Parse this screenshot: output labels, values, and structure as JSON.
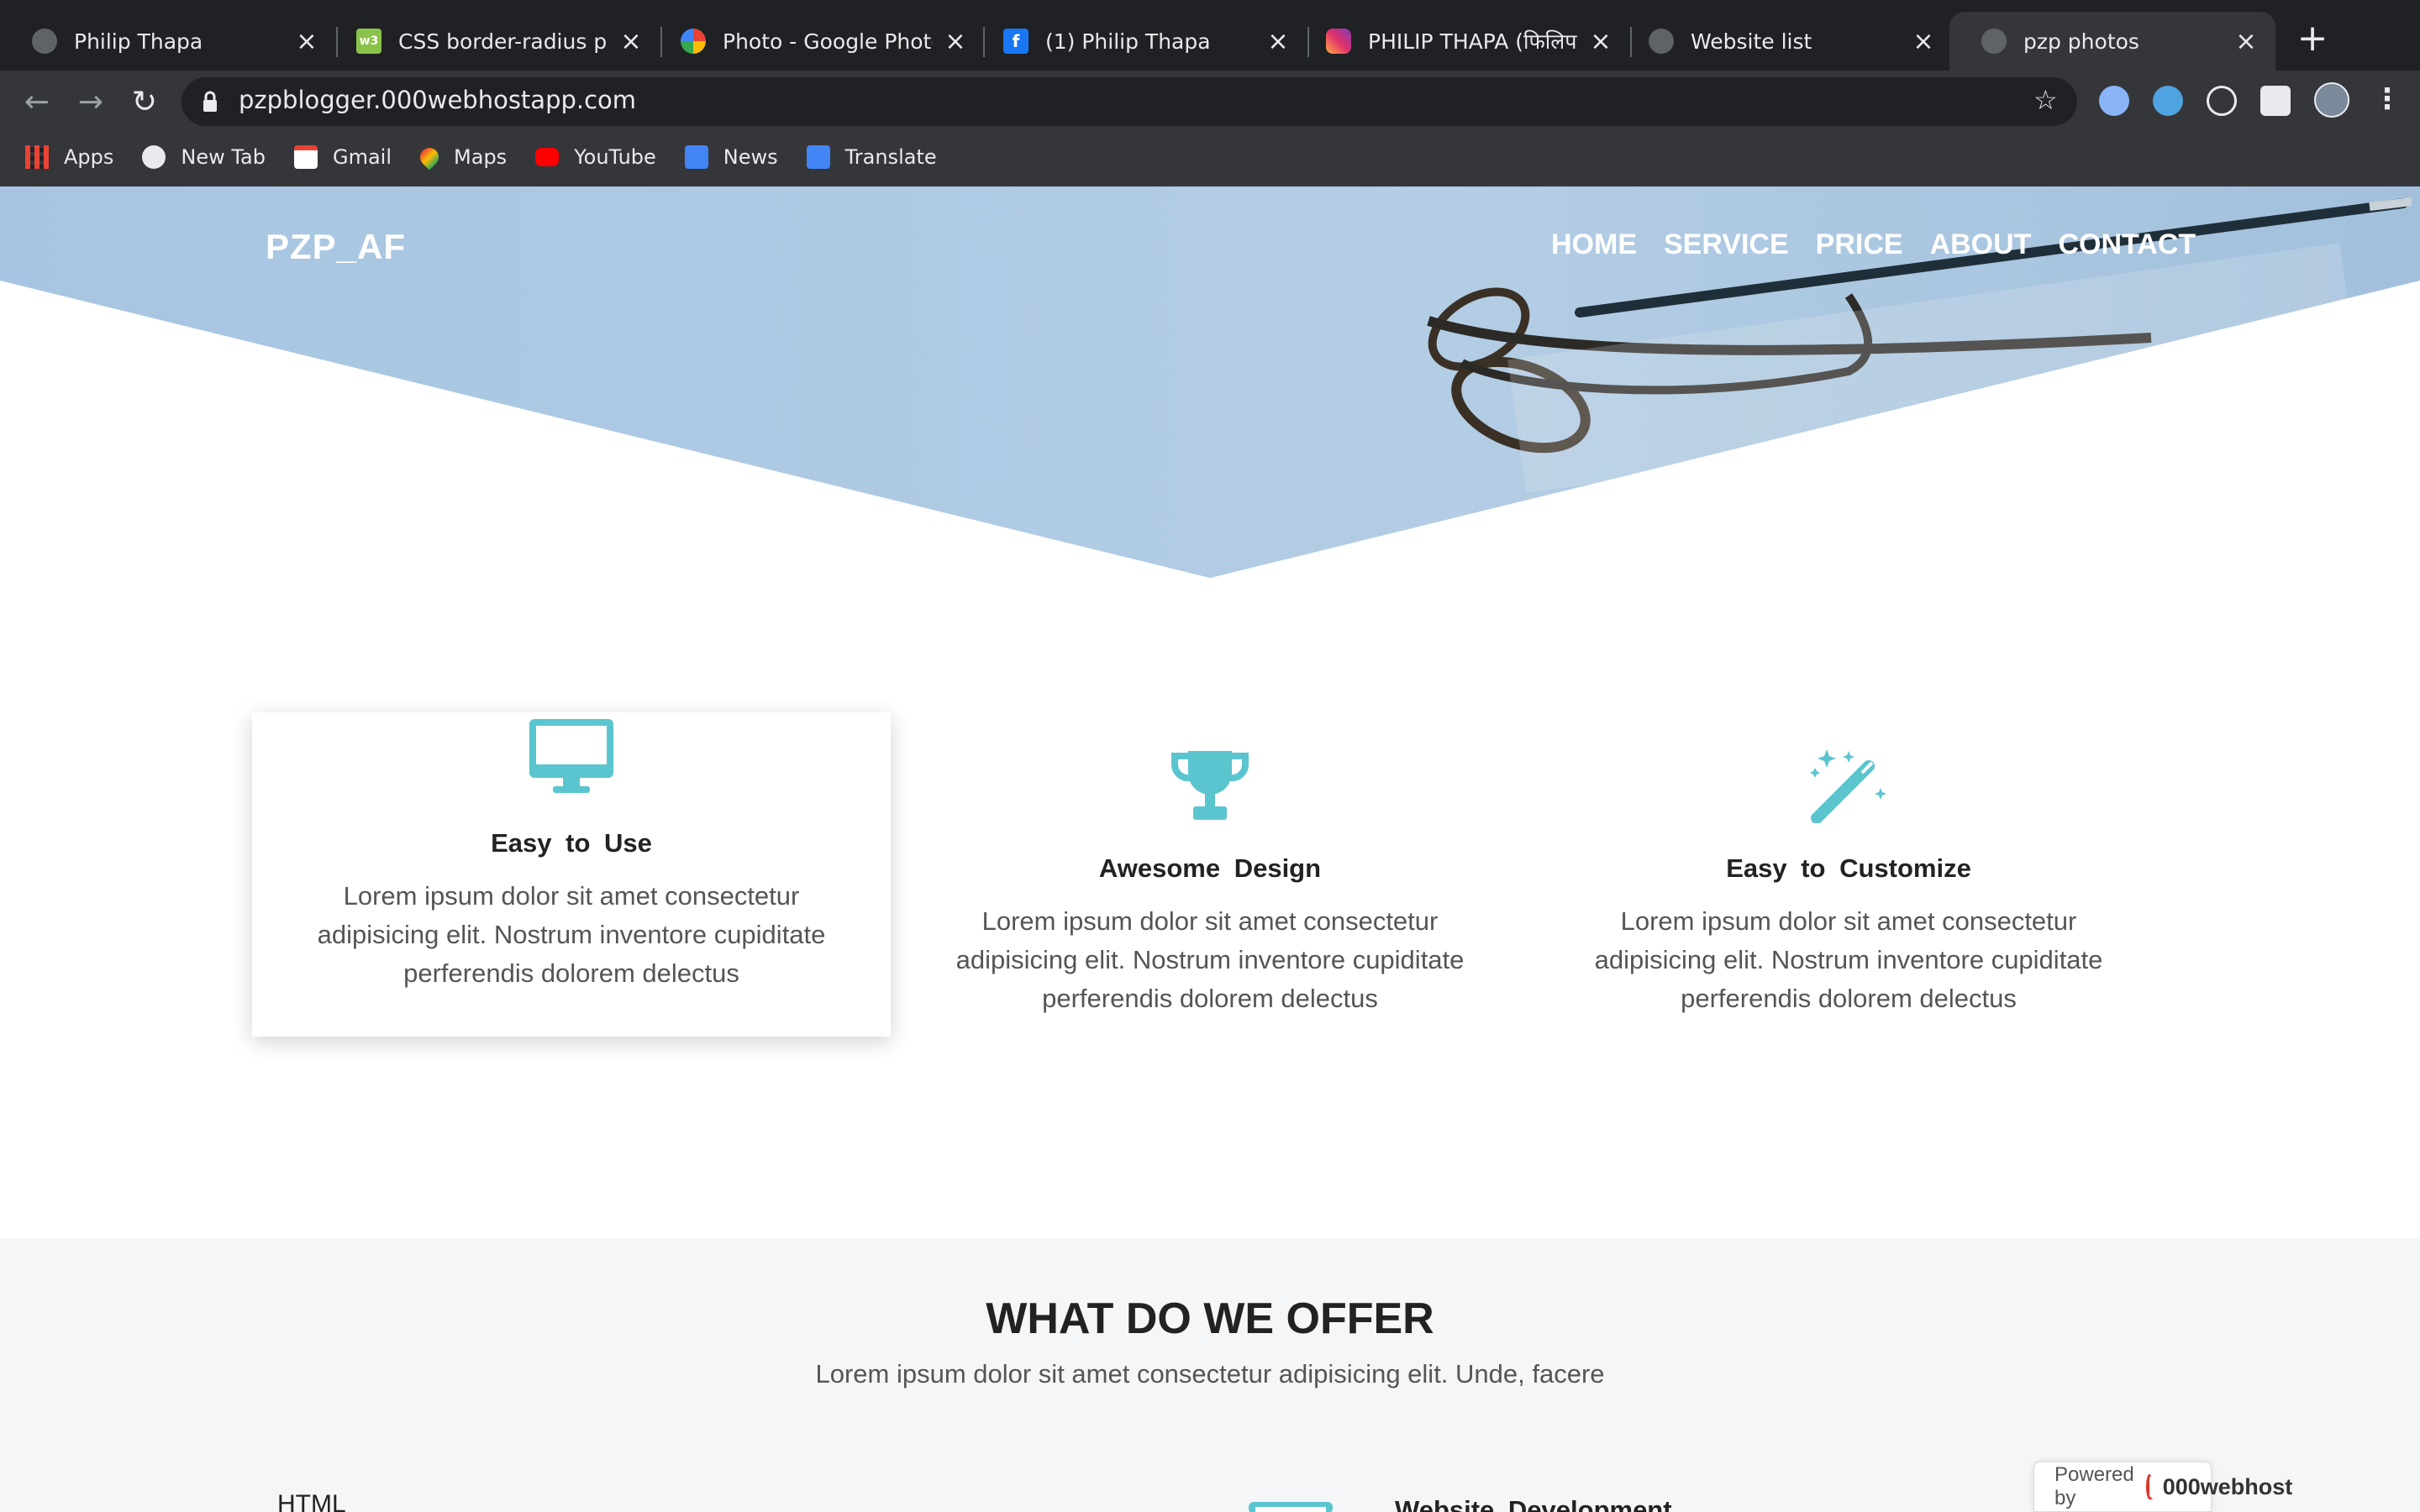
{
  "browser": {
    "tabs": [
      {
        "title": "Philip Thapa",
        "icon": "globe-icon",
        "active": false
      },
      {
        "title": "CSS border-radius pro",
        "icon": "w3-icon",
        "active": false
      },
      {
        "title": "Photo - Google Photos",
        "icon": "google-photos-icon",
        "active": false
      },
      {
        "title": "(1) Philip Thapa",
        "icon": "facebook-icon",
        "active": false
      },
      {
        "title": "PHILIP THAPA (फिलिप थ",
        "icon": "instagram-icon",
        "active": false
      },
      {
        "title": "Website list",
        "icon": "globe-icon",
        "active": false
      },
      {
        "title": "pzp photos",
        "icon": "globe-icon",
        "active": true
      }
    ],
    "url": "pzpblogger.000webhostapp.com",
    "bookmarks": [
      {
        "label": "Apps",
        "icon": "apps-grid-icon"
      },
      {
        "label": "New Tab",
        "icon": "globe-icon"
      },
      {
        "label": "Gmail",
        "icon": "gmail-icon"
      },
      {
        "label": "Maps",
        "icon": "maps-icon"
      },
      {
        "label": "YouTube",
        "icon": "youtube-icon"
      },
      {
        "label": "News",
        "icon": "news-icon"
      },
      {
        "label": "Translate",
        "icon": "translate-icon"
      }
    ]
  },
  "site": {
    "brand": "PZP_AF",
    "nav": [
      "HOME",
      "SERVICE",
      "PRICE",
      "ABOUT",
      "CONTACT"
    ],
    "accent": "#5bc5cf",
    "hero_color": "#a9c6e0",
    "features": [
      {
        "title": "Easy  to  Use",
        "icon": "monitor-icon",
        "text": "Lorem ipsum dolor sit amet consectetur adipisicing elit. Nostrum inventore cupiditate perferendis dolorem delectus"
      },
      {
        "title": "Awesome  Design",
        "icon": "trophy-icon",
        "text": "Lorem ipsum dolor sit amet consectetur adipisicing elit. Nostrum inventore cupiditate perferendis dolorem delectus"
      },
      {
        "title": "Easy  to  Customize",
        "icon": "magic-wand-icon",
        "text": "Lorem ipsum dolor sit amet consectetur adipisicing elit. Nostrum inventore cupiditate perferendis dolorem delectus"
      }
    ],
    "offer": {
      "title": "WHAT DO WE OFFER",
      "subtitle": "Lorem ipsum dolor sit amet consectetur adipisicing elit. Unde, facere",
      "skill_label": "HTML",
      "service_title": "Website  Development"
    },
    "powered": {
      "prefix": "Powered by",
      "brand": "000webhost"
    }
  }
}
